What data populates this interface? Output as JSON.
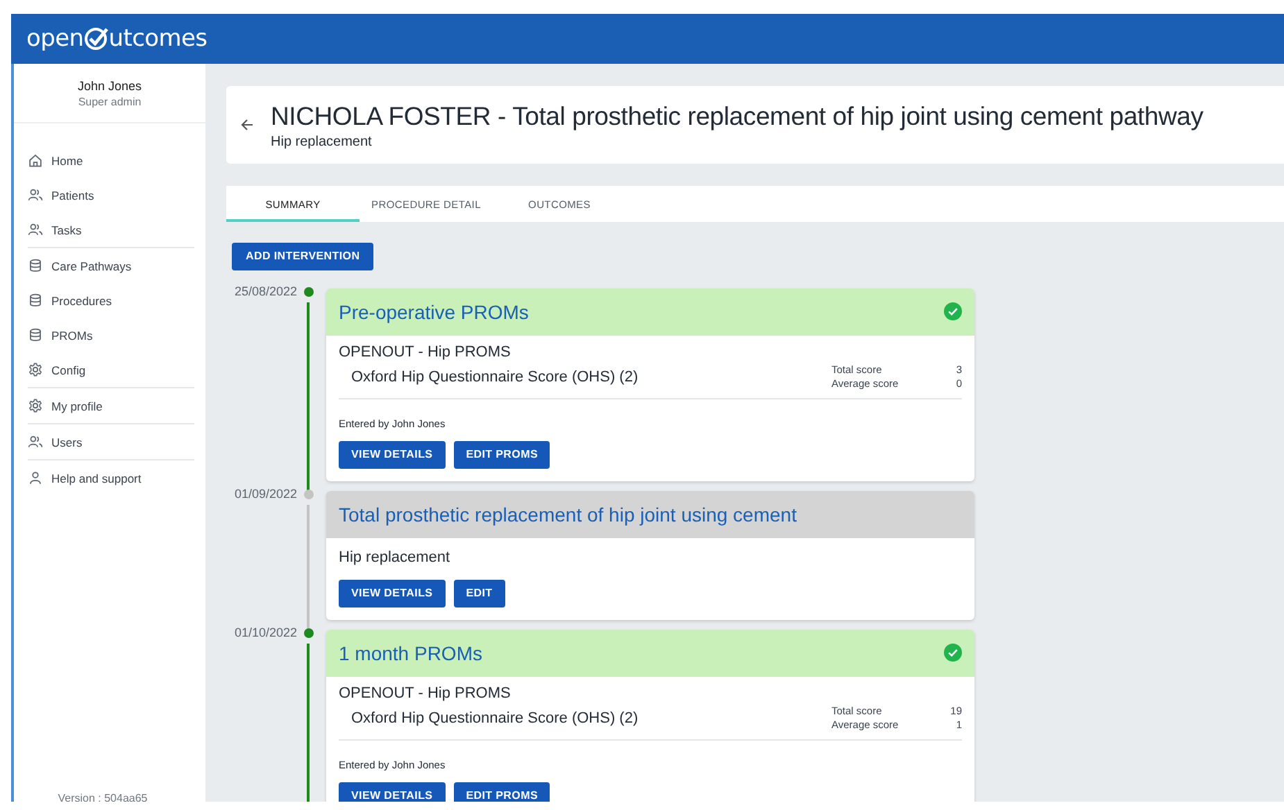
{
  "logo": {
    "before": "open",
    "after": "utcomes"
  },
  "user": {
    "name": "John Jones",
    "role": "Super admin"
  },
  "nav_groups": [
    [
      {
        "label": "Home"
      },
      {
        "label": "Patients"
      },
      {
        "label": "Tasks"
      }
    ],
    [
      {
        "label": "Care Pathways"
      },
      {
        "label": "Procedures"
      },
      {
        "label": "PROMs"
      },
      {
        "label": "Config"
      }
    ],
    [
      {
        "label": "My profile"
      }
    ],
    [
      {
        "label": "Users"
      }
    ],
    [
      {
        "label": "Help and support"
      }
    ]
  ],
  "version": "Version : 504aa65",
  "page": {
    "title": "NICHOLA FOSTER - Total prosthetic replacement of hip joint using cement pathway",
    "subtitle": "Hip replacement"
  },
  "tabs": [
    {
      "label": "SUMMARY",
      "selected": true
    },
    {
      "label": "PROCEDURE DETAIL",
      "selected": false
    },
    {
      "label": "OUTCOMES",
      "selected": false
    }
  ],
  "add_button": "ADD INTERVENTION",
  "timeline": [
    {
      "kind": "proms",
      "date": "25/08/2022",
      "completed": true,
      "title": "Pre-operative PROMs",
      "form": "OPENOUT - Hip PROMS",
      "questionnaire": "Oxford Hip Questionnaire Score (OHS) (2)",
      "scores": [
        {
          "label": "Total score",
          "value": "3"
        },
        {
          "label": "Average score",
          "value": "0"
        }
      ],
      "entered_by": "Entered by John Jones",
      "buttons": [
        "VIEW DETAILS",
        "EDIT PROMS"
      ]
    },
    {
      "kind": "procedure",
      "date": "01/09/2022",
      "completed": false,
      "title": "Total prosthetic replacement of hip joint using cement",
      "description": "Hip replacement",
      "buttons": [
        "VIEW DETAILS",
        "EDIT"
      ]
    },
    {
      "kind": "proms",
      "date": "01/10/2022",
      "completed": true,
      "title": "1 month PROMs",
      "form": "OPENOUT - Hip PROMS",
      "questionnaire": "Oxford Hip Questionnaire Score (OHS) (2)",
      "scores": [
        {
          "label": "Total score",
          "value": "19"
        },
        {
          "label": "Average score",
          "value": "1"
        }
      ],
      "entered_by": "Entered by John Jones",
      "buttons": [
        "VIEW DETAILS",
        "EDIT PROMS"
      ]
    }
  ]
}
